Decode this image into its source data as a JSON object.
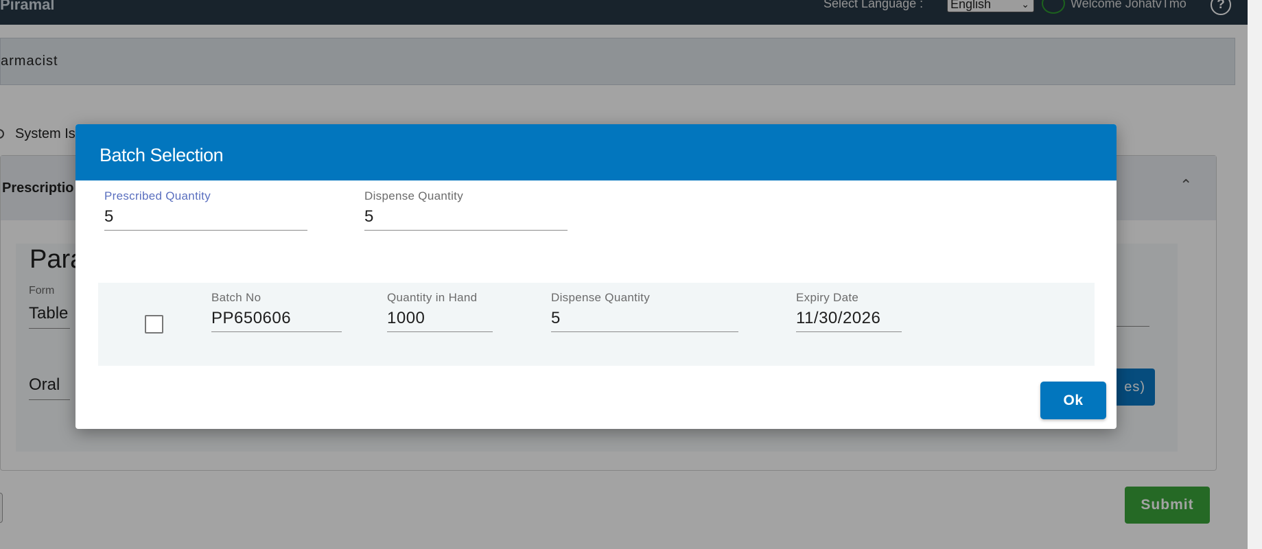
{
  "app": {
    "brand": "Piramal",
    "language_label": "Select Language :",
    "language_selected": "English",
    "welcome_text": "Welcome JohatvTmo",
    "help_glyph": "?"
  },
  "page": {
    "role_text": "armacist",
    "radio_label": "System Is",
    "card_title": "Prescriptio",
    "panel_title": "Para",
    "form_label": "Form",
    "form_value": "Table",
    "route_value": "Oral",
    "partial_button_label": "es)",
    "submit_label": "Submit"
  },
  "dialog": {
    "title": "Batch Selection",
    "prescribed_quantity": {
      "label": "Prescribed Quantity",
      "value": "5"
    },
    "dispense_quantity": {
      "label": "Dispense Quantity",
      "value": "5"
    },
    "batch": {
      "checked": false,
      "batch_no": {
        "label": "Batch No",
        "value": "PP650606"
      },
      "quantity_in_hand": {
        "label": "Quantity in Hand",
        "value": "1000"
      },
      "dispense_quantity": {
        "label": "Dispense Quantity",
        "value": "5"
      },
      "expiry_date": {
        "label": "Expiry Date",
        "value": "11/30/2026"
      }
    },
    "ok_label": "Ok"
  },
  "colors": {
    "header_blue": "#0276be",
    "topbar": "#263746",
    "submit_green": "#3aa53a",
    "focus_label": "#5a6fbf"
  },
  "icons": {
    "language_dropdown": "chevron-down-icon",
    "globe": "globe-icon",
    "help": "help-circle-icon",
    "card_collapse": "chevron-up-icon"
  }
}
